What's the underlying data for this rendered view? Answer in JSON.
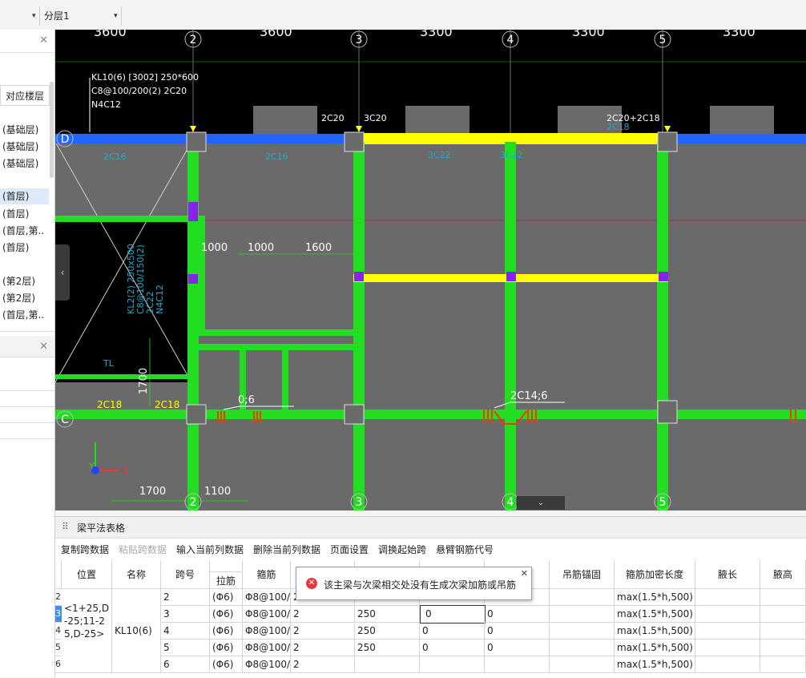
{
  "topbar": {
    "left_caret": "▾",
    "layer_select": "分层1",
    "layer_caret": "▾"
  },
  "left_panel": {
    "close": "✕",
    "column_header": "对应楼层",
    "items": [
      "(基础层)",
      "(基础层)",
      "(基础层)",
      "(首层)",
      "(首层)",
      "(首层,第..",
      "(首层)",
      "(第2层)",
      "(第2层)",
      "(首层,第.."
    ],
    "close2": "✕"
  },
  "canvas": {
    "top_dims": [
      "3600",
      "3600",
      "3300",
      "3300",
      "3300"
    ],
    "axis_numbers": [
      "2",
      "3",
      "4",
      "5"
    ],
    "axis_letters": [
      "D",
      "C"
    ],
    "beam_info": [
      "KL10(6) [3002] 250*600",
      "C8@100/200(2) 2C20",
      "N4C12"
    ],
    "labels": {
      "d_2c20": "2C20",
      "d_3c20": "3C20",
      "d_2c20_2c18": "2C20+2C18",
      "d_2c18_sub": "2C18",
      "d_2c16_a": "2C16",
      "d_2c16_b": "2C16",
      "d_3c22": "3C22",
      "d_3c22_b": "3C22",
      "dim_1000_a": "1000",
      "dim_1000_b": "1000",
      "dim_1600": "1600",
      "dim_1700_v": "1700",
      "dim_1700_h": "1700",
      "dim_1100": "1100",
      "c_2c18_a": "2C18",
      "c_2c18_b": "2C18",
      "c_06": "0;6",
      "c_2c14_6": "2C14;6",
      "tl": "TL",
      "kl_vert_1": "KL2(2) 250x500",
      "kl_vert_2": "C8@100/150(2)",
      "kl_vert_3": "2C22",
      "kl_vert_4": "N4C12",
      "axis_y": "Y",
      "axis_x": "X"
    },
    "collapse_arrow": "‹",
    "bottom_arrow": "⌄"
  },
  "table_panel": {
    "title": "梁平法表格",
    "grip": "⠿",
    "toolbar": [
      {
        "label": "复制跨数据",
        "enabled": true
      },
      {
        "label": "粘贴跨数据",
        "enabled": false
      },
      {
        "label": "输入当前列数据",
        "enabled": true
      },
      {
        "label": "删除当前列数据",
        "enabled": true
      },
      {
        "label": "页面设置",
        "enabled": true
      },
      {
        "label": "调换起始跨",
        "enabled": true
      },
      {
        "label": "悬臂钢筋代号",
        "enabled": true
      }
    ],
    "headers": {
      "position": "位置",
      "name": "名称",
      "span": "跨号",
      "tie": "拉筋",
      "stirrup": "箍筋",
      "hanger_anchor": "吊筋锚固",
      "dense_len": "箍筋加密长度",
      "haunch_len": "腋长",
      "haunch_h": "腋高"
    },
    "merged": {
      "position": "<1+25,D-25;11-25,D-25>",
      "name": "KL10(6)"
    },
    "rows": [
      {
        "rownum": "2",
        "span": "2",
        "tie": "(Φ6)",
        "stirrup": "Φ8@100/",
        "limb": "2",
        "width": "",
        "hanger": "",
        "hanger2": "",
        "dense": "max(1.5*h,500)"
      },
      {
        "rownum": "3",
        "span": "3",
        "tie": "(Φ6)",
        "stirrup": "Φ8@100/",
        "limb": "2",
        "width": "250",
        "hanger": "0",
        "hanger2": "0",
        "dense": "max(1.5*h,500)"
      },
      {
        "rownum": "4",
        "span": "4",
        "tie": "(Φ6)",
        "stirrup": "Φ8@100/",
        "limb": "2",
        "width": "250",
        "hanger": "0",
        "hanger2": "0",
        "dense": "max(1.5*h,500)"
      },
      {
        "rownum": "5",
        "span": "5",
        "tie": "(Φ6)",
        "stirrup": "Φ8@100/",
        "limb": "2",
        "width": "250",
        "hanger": "0",
        "hanger2": "0",
        "dense": "max(1.5*h,500)"
      },
      {
        "rownum": "6",
        "span": "6",
        "tie": "(Φ6)",
        "stirrup": "Φ8@100/",
        "limb": "2",
        "width": "",
        "hanger": "",
        "hanger2": "",
        "dense": "max(1.5*h,500)"
      }
    ]
  },
  "tooltip": {
    "icon": "✕",
    "message": "该主梁与次梁相交处没有生成次梁加筋或吊筋",
    "close": "✕"
  },
  "colors": {
    "canvas_bg": "#000000",
    "beam_green": "#22dd22",
    "beam_yellow": "#ffff00",
    "beam_blue": "#2266ff",
    "slab_gray": "#6a6a6a",
    "text_white": "#ffffff",
    "rebar_red": "#ff3300",
    "annot_cyan": "#22aacc"
  }
}
